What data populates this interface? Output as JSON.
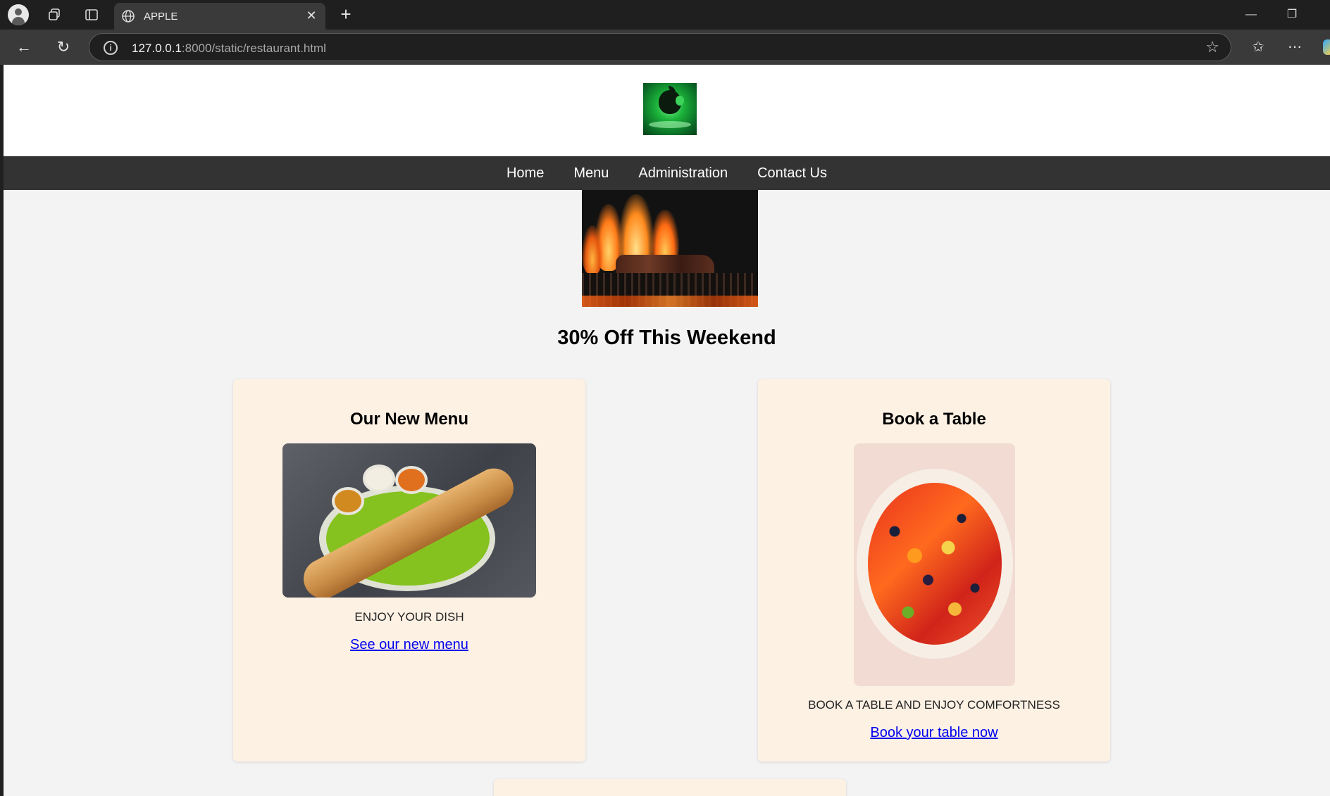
{
  "browser": {
    "tab_title": "APPLE",
    "url_host": "127.0.0.1",
    "url_rest": ":8000/static/restaurant.html",
    "new_tab_label": "+"
  },
  "site": {
    "nav": [
      "Home",
      "Menu",
      "Administration",
      "Contact Us"
    ],
    "promo": "30% Off This Weekend",
    "cards": [
      {
        "title": "Our New Menu",
        "description": "ENJOY YOUR DISH",
        "link": "See our new menu"
      },
      {
        "title": "Book a Table",
        "description": "BOOK A TABLE AND ENJOY COMFORTNESS",
        "link": "Book your table now"
      }
    ]
  },
  "colors": {
    "nav_bg": "#333333",
    "card_bg": "#fdf1e4",
    "page_bg": "#f3f3f3",
    "link": "#0000ee"
  },
  "icons": [
    "profile-icon",
    "workspaces-icon",
    "tab-actions-icon",
    "globe-icon",
    "close-icon",
    "back-icon",
    "refresh-icon",
    "info-icon",
    "favorite-star-icon",
    "favorites-icon",
    "more-icon",
    "minimize-icon",
    "restore-icon"
  ]
}
